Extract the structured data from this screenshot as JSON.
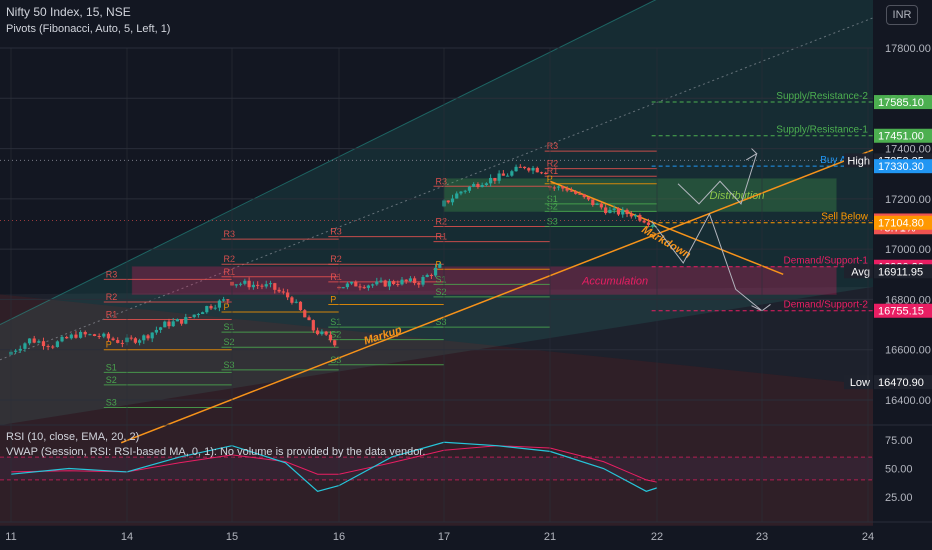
{
  "header": {
    "symbol_line": "Nifty 50 Index, 15, NSE",
    "indicator_line": "Pivots (Fibonacci, Auto, 5, Left, 1)",
    "rsi_line": "RSI (10, close, EMA, 20, 2)",
    "vwap_line": "VWAP (Session, RSI: RSI-based MA, 0, 1): No volume is provided by the data vendor."
  },
  "currency_button": "INR",
  "colors": {
    "background": "#131722",
    "up": "#26a69a",
    "down": "#ef5350",
    "markup_line": "#f7931a",
    "supply": "#4caf50",
    "demand": "#e91e63",
    "sell_below": "#ff9800",
    "buy_above": "#2196f3",
    "rsi": "#26c6da",
    "rsi_ma": "#e91e63"
  },
  "chart_data": [
    {
      "type": "candlestick",
      "title": "Nifty 50 Index, 15, NSE",
      "x_ticks": [
        "11",
        "14",
        "15",
        "16",
        "17",
        "21",
        "22",
        "23",
        "24"
      ],
      "y_ticks": [
        16400,
        16600,
        16800,
        17000,
        17200,
        17400,
        17600,
        17800
      ],
      "ylim": [
        16310,
        17980
      ],
      "series": [
        {
          "day": "11",
          "x": [
            0,
            0.2,
            0.4,
            0.6,
            0.8,
            1.0
          ],
          "close": [
            16580,
            16640,
            16620,
            16660,
            16655,
            16630
          ]
        },
        {
          "day": "14",
          "x": [
            1.0,
            1.2,
            1.4,
            1.6,
            1.8,
            2.0
          ],
          "close": [
            16630,
            16650,
            16700,
            16720,
            16770,
            16800
          ]
        },
        {
          "day": "15",
          "x": [
            2.0,
            2.2,
            2.4,
            2.6,
            2.8,
            3.0
          ],
          "close": [
            16870,
            16860,
            16850,
            16800,
            16680,
            16630
          ]
        },
        {
          "day": "16",
          "x": [
            3.0,
            3.2,
            3.4,
            3.6,
            3.8,
            4.0
          ],
          "close": [
            16850,
            16860,
            16860,
            16870,
            16870,
            16930
          ]
        },
        {
          "day": "17",
          "x": [
            4.0,
            4.2,
            4.4,
            4.6,
            4.8,
            5.0
          ],
          "close": [
            17170,
            17230,
            17270,
            17290,
            17330,
            17310
          ]
        },
        {
          "day": "21",
          "x": [
            5.0,
            5.2,
            5.4,
            5.6,
            5.8,
            6.0
          ],
          "close": [
            17250,
            17240,
            17190,
            17150,
            17140,
            17104
          ]
        }
      ],
      "price_labels": [
        {
          "text": "17585.10",
          "value": 17585,
          "color": "#4caf50"
        },
        {
          "text": "17451.00",
          "value": 17451,
          "color": "#4caf50"
        },
        {
          "text": "17353.35",
          "value": 17353,
          "color": "#1e222d"
        },
        {
          "text": "17330.30",
          "value": 17330,
          "color": "#2196f3"
        },
        {
          "text": "17113.85",
          "value": 17114,
          "color": "#ef5350"
        },
        {
          "text": "+3.71%",
          "value": 17087,
          "color": "#ef5350"
        },
        {
          "text": "17104.80",
          "value": 17105,
          "color": "#ff9800"
        },
        {
          "text": "16930.30",
          "value": 16930,
          "color": "#e91e63"
        },
        {
          "text": "16911.95",
          "value": 16912,
          "color": "#1e222d"
        },
        {
          "text": "16755.15",
          "value": 16755,
          "color": "#e91e63"
        },
        {
          "text": "16470.90",
          "value": 16471,
          "color": "#1e222d"
        }
      ],
      "side_tags": [
        {
          "text": "High",
          "value": 17353
        },
        {
          "text": "Avg",
          "value": 16912
        },
        {
          "text": "Low",
          "value": 16471
        }
      ],
      "level_labels": [
        {
          "text": "Supply/Resistance-2",
          "value": 17585,
          "color": "#4caf50"
        },
        {
          "text": "Supply/Resistance-1",
          "value": 17451,
          "color": "#4caf50"
        },
        {
          "text": "Buy Above",
          "value": 17330,
          "color": "#2196f3"
        },
        {
          "text": "Sell Below",
          "value": 17105,
          "color": "#ff9800"
        },
        {
          "text": "Demand/Support-1",
          "value": 16930,
          "color": "#e91e63"
        },
        {
          "text": "Demand/Support-2",
          "value": 16755,
          "color": "#e91e63"
        }
      ],
      "zones": [
        {
          "label": "Distribution",
          "color": "#4caf50"
        },
        {
          "label": "Accumulation",
          "color": "#e91e63"
        }
      ],
      "trend_labels": [
        "Markup",
        "Markdown"
      ],
      "pivot_labels": [
        "R3",
        "R2",
        "R1",
        "P",
        "S1",
        "S2",
        "S3"
      ]
    },
    {
      "type": "line",
      "title": "RSI (10, close, EMA, 20, 2)",
      "y_ticks": [
        25.0,
        50.0,
        75.0
      ],
      "ylim": [
        0,
        100
      ],
      "bands": [
        40,
        60
      ],
      "series": [
        {
          "x": [
            0,
            0.5,
            1,
            1.5,
            2,
            2.5,
            2.8,
            3,
            3.5,
            4,
            4.5,
            5,
            5.5,
            5.9,
            6
          ],
          "values": [
            45,
            50,
            47,
            60,
            70,
            55,
            30,
            35,
            60,
            73,
            70,
            65,
            50,
            30,
            33
          ]
        },
        {
          "x": [
            0,
            0.5,
            1,
            1.5,
            2,
            2.5,
            2.8,
            3,
            3.5,
            4,
            4.5,
            5,
            5.5,
            5.9,
            6
          ],
          "values": [
            47,
            48,
            47,
            55,
            62,
            56,
            45,
            45,
            55,
            66,
            70,
            68,
            56,
            40,
            38
          ]
        }
      ]
    }
  ]
}
